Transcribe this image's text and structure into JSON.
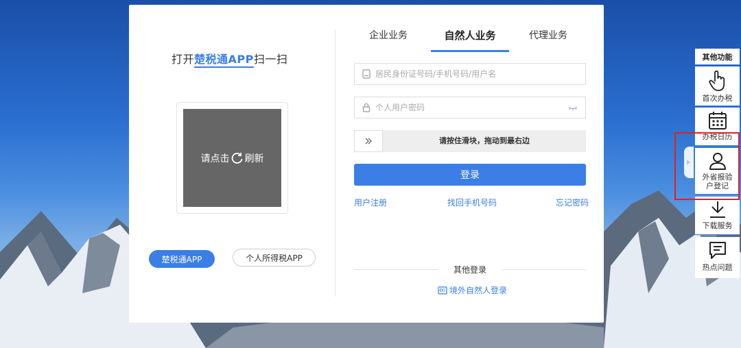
{
  "qr": {
    "title_prefix": "打开",
    "title_brand": "楚税通APP",
    "title_suffix": "扫一扫",
    "refresh_prefix": "请点击",
    "refresh_suffix": "刷新"
  },
  "app_buttons": {
    "chushui": "楚税通APP",
    "geshui": "个人所得税APP"
  },
  "tabs": [
    "企业业务",
    "自然人业务",
    "代理业务"
  ],
  "active_tab": "自然人业务",
  "form": {
    "id_placeholder": "居民身份证号码/手机号码/用户名",
    "password_placeholder": "个人用户密码",
    "slider_text": "请按住滑块，拖动到最右边",
    "login_label": "登录"
  },
  "links": {
    "register": "用户注册",
    "recover_phone": "找回手机号码",
    "forgot_password": "忘记密码"
  },
  "other_login": {
    "title": "其他登录",
    "overseas": "境外自然人登录"
  },
  "sidebar": {
    "header": "其他功能",
    "items": [
      {
        "label": "首次办税",
        "icon": "hand-pointer-icon"
      },
      {
        "label": "办税日历",
        "icon": "calendar-icon"
      },
      {
        "label": "外省报验户登记",
        "icon": "user-icon"
      },
      {
        "label": "下载服务",
        "icon": "download-icon"
      },
      {
        "label": "热点问题",
        "icon": "chat-icon"
      }
    ]
  },
  "colors": {
    "accent": "#3a7ee6",
    "highlight": "#e02020",
    "qr_placeholder": "#666666"
  }
}
